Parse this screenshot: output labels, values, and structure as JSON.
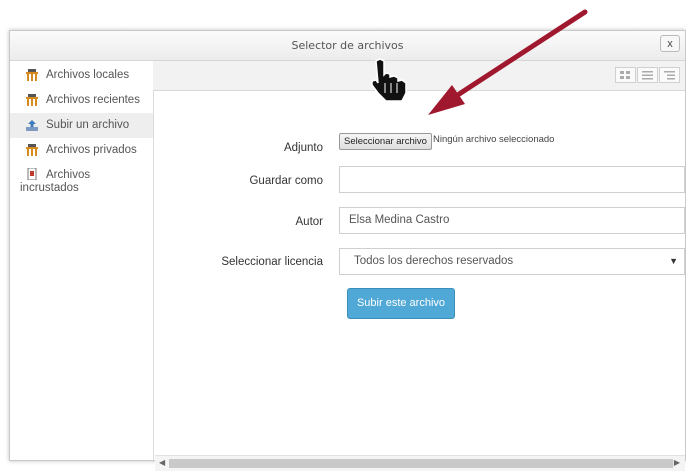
{
  "window": {
    "title": "Selector de archivos",
    "close_label": "x"
  },
  "sidebar": {
    "items": [
      {
        "label": "Archivos locales",
        "icon": "repository-icon"
      },
      {
        "label": "Archivos recientes",
        "icon": "repository-icon"
      },
      {
        "label": "Subir un archivo",
        "icon": "upload-icon",
        "active": true
      },
      {
        "label": "Archivos privados",
        "icon": "repository-icon"
      },
      {
        "label": "Archivos",
        "label_line2": "incrustados",
        "icon": "document-icon"
      }
    ]
  },
  "toolbar": {
    "view_buttons": [
      "grid-view-icon",
      "list-view-icon",
      "tree-view-icon"
    ]
  },
  "form": {
    "attachment_label": "Adjunto",
    "choose_file_button": "Seleccionar archivo",
    "file_status": "Ningún archivo seleccionado",
    "save_as_label": "Guardar como",
    "save_as_value": "",
    "author_label": "Autor",
    "author_value": "Elsa Medina Castro",
    "license_label": "Seleccionar licencia",
    "license_value": "Todos los derechos reservados",
    "upload_button": "Subir este archivo"
  },
  "colors": {
    "accent": "#4fa8d6",
    "annotation_arrow": "#a0182e"
  },
  "overlay": {
    "cursor_icon": "hand-pointer-icon",
    "arrow_icon": "red-arrow-annotation"
  }
}
